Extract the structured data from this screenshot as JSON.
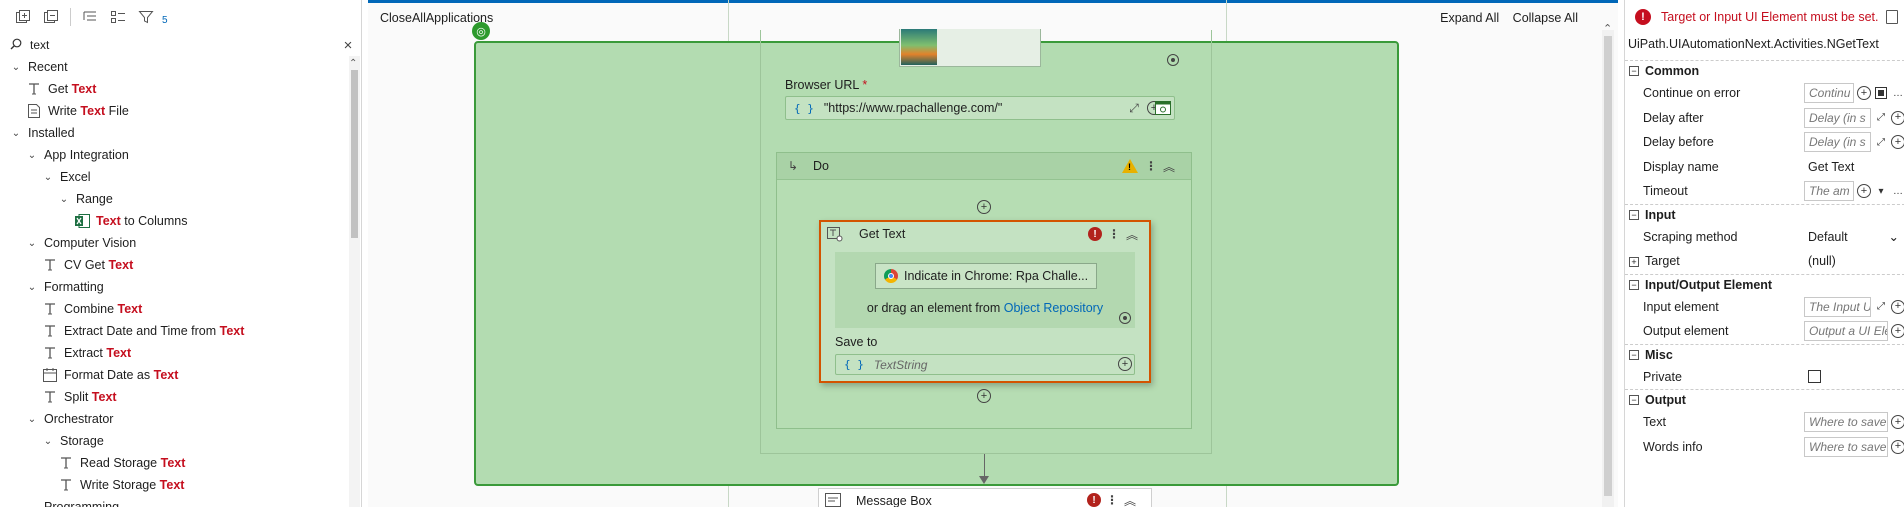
{
  "activities": {
    "filter_count": "5",
    "search": {
      "value": "text"
    },
    "tree": [
      {
        "level": 0,
        "type": "group",
        "expanded": true,
        "parts": [
          {
            "t": "Recent",
            "h": false
          }
        ]
      },
      {
        "level": 1,
        "type": "activity",
        "icon": "get-text-icon",
        "parts": [
          {
            "t": "Get ",
            "h": false
          },
          {
            "t": "Text",
            "h": true
          }
        ]
      },
      {
        "level": 1,
        "type": "activity",
        "icon": "write-text-file-icon",
        "parts": [
          {
            "t": "Write ",
            "h": false
          },
          {
            "t": "Text",
            "h": true
          },
          {
            "t": " File",
            "h": false
          }
        ]
      },
      {
        "level": 0,
        "type": "group",
        "expanded": true,
        "parts": [
          {
            "t": "Installed",
            "h": false
          }
        ]
      },
      {
        "level": 1,
        "type": "group",
        "expanded": true,
        "parts": [
          {
            "t": "App Integration",
            "h": false
          }
        ]
      },
      {
        "level": 2,
        "type": "group",
        "expanded": true,
        "parts": [
          {
            "t": "Excel",
            "h": false
          }
        ]
      },
      {
        "level": 3,
        "type": "group",
        "expanded": true,
        "parts": [
          {
            "t": "Range",
            "h": false
          }
        ]
      },
      {
        "level": 4,
        "type": "activity",
        "icon": "excel-icon",
        "parts": [
          {
            "t": "Text",
            "h": true
          },
          {
            "t": " to Columns",
            "h": false
          }
        ]
      },
      {
        "level": 1,
        "type": "group",
        "expanded": true,
        "parts": [
          {
            "t": "Computer Vision",
            "h": false
          }
        ]
      },
      {
        "level": 2,
        "type": "activity",
        "icon": "cv-get-text-icon",
        "parts": [
          {
            "t": "CV Get ",
            "h": false
          },
          {
            "t": "Text",
            "h": true
          }
        ]
      },
      {
        "level": 1,
        "type": "group",
        "expanded": true,
        "parts": [
          {
            "t": "Formatting",
            "h": false
          }
        ]
      },
      {
        "level": 2,
        "type": "activity",
        "icon": "combine-text-icon",
        "parts": [
          {
            "t": "Combine ",
            "h": false
          },
          {
            "t": "Text",
            "h": true
          }
        ]
      },
      {
        "level": 2,
        "type": "activity",
        "icon": "extract-date-icon",
        "parts": [
          {
            "t": "Extract Date and Time from ",
            "h": false
          },
          {
            "t": "Text",
            "h": true
          }
        ]
      },
      {
        "level": 2,
        "type": "activity",
        "icon": "extract-text-icon",
        "parts": [
          {
            "t": "Extract ",
            "h": false
          },
          {
            "t": "Text",
            "h": true
          }
        ]
      },
      {
        "level": 2,
        "type": "activity",
        "icon": "calendar-icon",
        "parts": [
          {
            "t": "Format Date as ",
            "h": false
          },
          {
            "t": "Text",
            "h": true
          }
        ]
      },
      {
        "level": 2,
        "type": "activity",
        "icon": "split-text-icon",
        "parts": [
          {
            "t": "Split ",
            "h": false
          },
          {
            "t": "Text",
            "h": true
          }
        ]
      },
      {
        "level": 1,
        "type": "group",
        "expanded": true,
        "parts": [
          {
            "t": "Orchestrator",
            "h": false
          }
        ]
      },
      {
        "level": 2,
        "type": "group",
        "expanded": true,
        "parts": [
          {
            "t": "Storage",
            "h": false
          }
        ]
      },
      {
        "level": 3,
        "type": "activity",
        "icon": "read-storage-text-icon",
        "parts": [
          {
            "t": "Read Storage ",
            "h": false
          },
          {
            "t": "Text",
            "h": true
          }
        ]
      },
      {
        "level": 3,
        "type": "activity",
        "icon": "write-storage-text-icon",
        "parts": [
          {
            "t": "Write Storage ",
            "h": false
          },
          {
            "t": "Text",
            "h": true
          }
        ]
      },
      {
        "level": 1,
        "type": "group",
        "expanded": true,
        "parts": [
          {
            "t": "Programming",
            "h": false
          }
        ]
      }
    ]
  },
  "designer": {
    "breadcrumb": "CloseAllApplications",
    "expand_all": "Expand All",
    "collapse_all": "Collapse All",
    "browser_url_label": "Browser URL",
    "required_mark": "*",
    "browser_url_value": "\"https://www.rpachallenge.com/\"",
    "brace": "{ }",
    "do_title": "Do",
    "get_text_title": "Get Text",
    "indicate_label": "Indicate in Chrome: Rpa Challe...",
    "drag_prefix": "or drag an element from ",
    "drag_link": "Object Repository",
    "save_to_label": "Save to",
    "save_to_placeholder": "TextString",
    "message_box_title": "Message Box"
  },
  "properties": {
    "error": "Target or Input UI Element must be set.",
    "type_name": "UiPath.UIAutomationNext.Activities.NGetText",
    "categories": {
      "common": "Common",
      "input": "Input",
      "io": "Input/Output Element",
      "misc": "Misc",
      "output": "Output"
    },
    "rows": {
      "continue_on_error": {
        "name": "Continue on error",
        "placeholder": "Continu"
      },
      "delay_after": {
        "name": "Delay after",
        "placeholder": "Delay (in s"
      },
      "delay_before": {
        "name": "Delay before",
        "placeholder": "Delay (in s"
      },
      "display_name": {
        "name": "Display name",
        "value": "Get Text"
      },
      "timeout": {
        "name": "Timeout",
        "placeholder": "The am"
      },
      "scraping_method": {
        "name": "Scraping method",
        "value": "Default"
      },
      "target": {
        "name": "Target",
        "value": "(null)"
      },
      "input_element": {
        "name": "Input element",
        "placeholder": "The Input U"
      },
      "output_element": {
        "name": "Output element",
        "placeholder": "Output a UI Ele"
      },
      "private": {
        "name": "Private"
      },
      "text": {
        "name": "Text",
        "placeholder": "Where to save"
      },
      "words_info": {
        "name": "Words info",
        "placeholder": "Where to save"
      }
    }
  }
}
